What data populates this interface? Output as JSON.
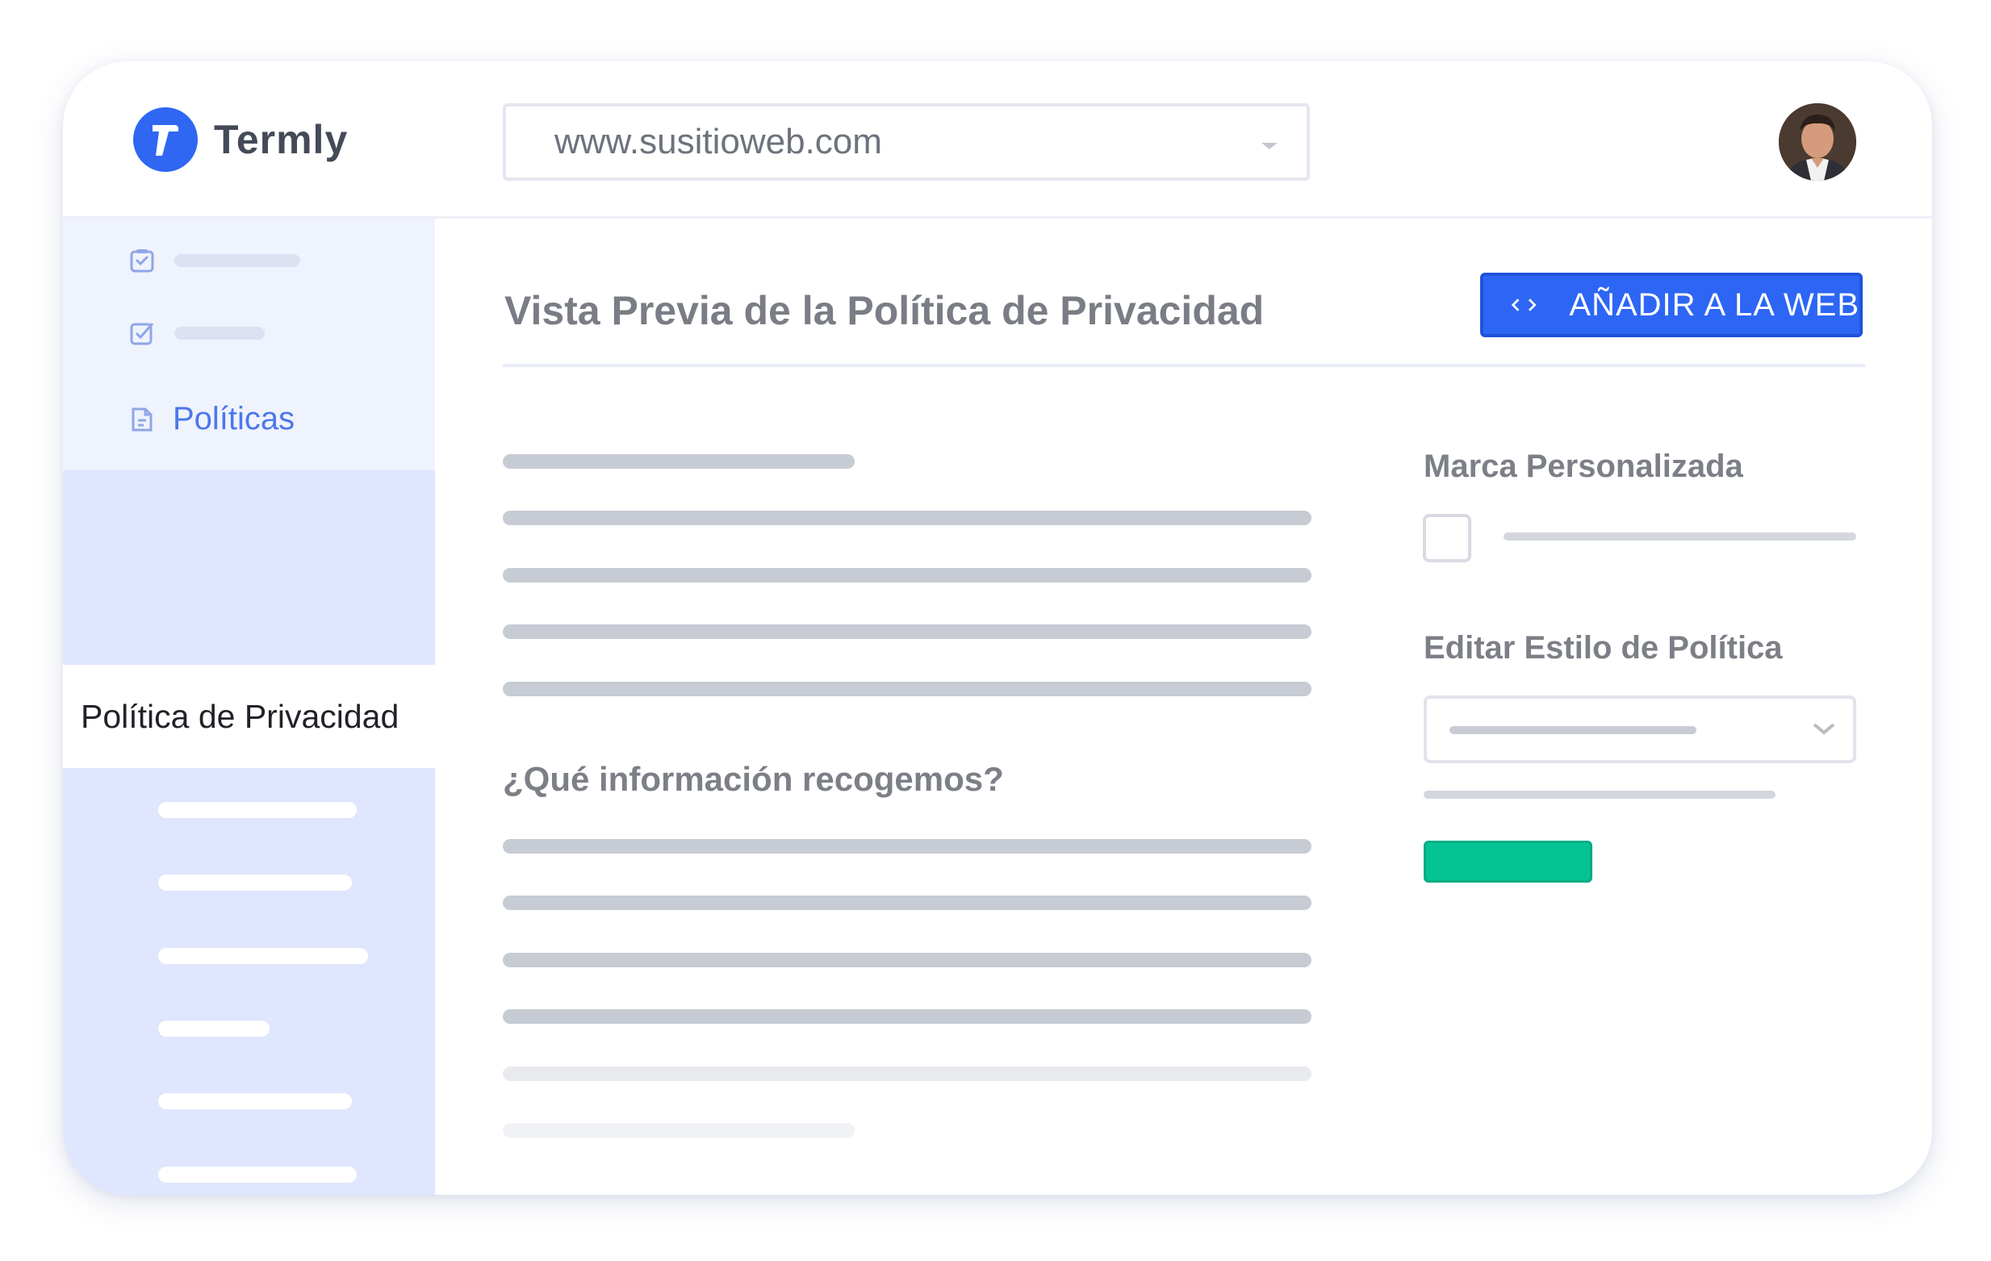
{
  "brand": {
    "name": "Termly",
    "accent": "#2f67f3"
  },
  "header": {
    "site_select_value": "www.susitioweb.com",
    "avatar_icon": "user-avatar"
  },
  "sidebar": {
    "items": [
      {
        "icon": "checklist-icon",
        "label": ""
      },
      {
        "icon": "checkbox-icon",
        "label": ""
      },
      {
        "icon": "document-icon",
        "label": "Políticas"
      }
    ],
    "active_item": {
      "label": "Política de Privacidad"
    },
    "background": "#dfe6fd"
  },
  "main": {
    "title": "Vista Previa de la Política de Privacidad",
    "add_button_label": "AÑADIR A LA WEB",
    "add_button_icon": "code-icon",
    "section_heading": "¿Qué información recogemos?"
  },
  "panel": {
    "custom_brand_label": "Marca Personalizada",
    "edit_style_label": "Editar Estilo de Política",
    "save_button_color": "#05c494"
  }
}
